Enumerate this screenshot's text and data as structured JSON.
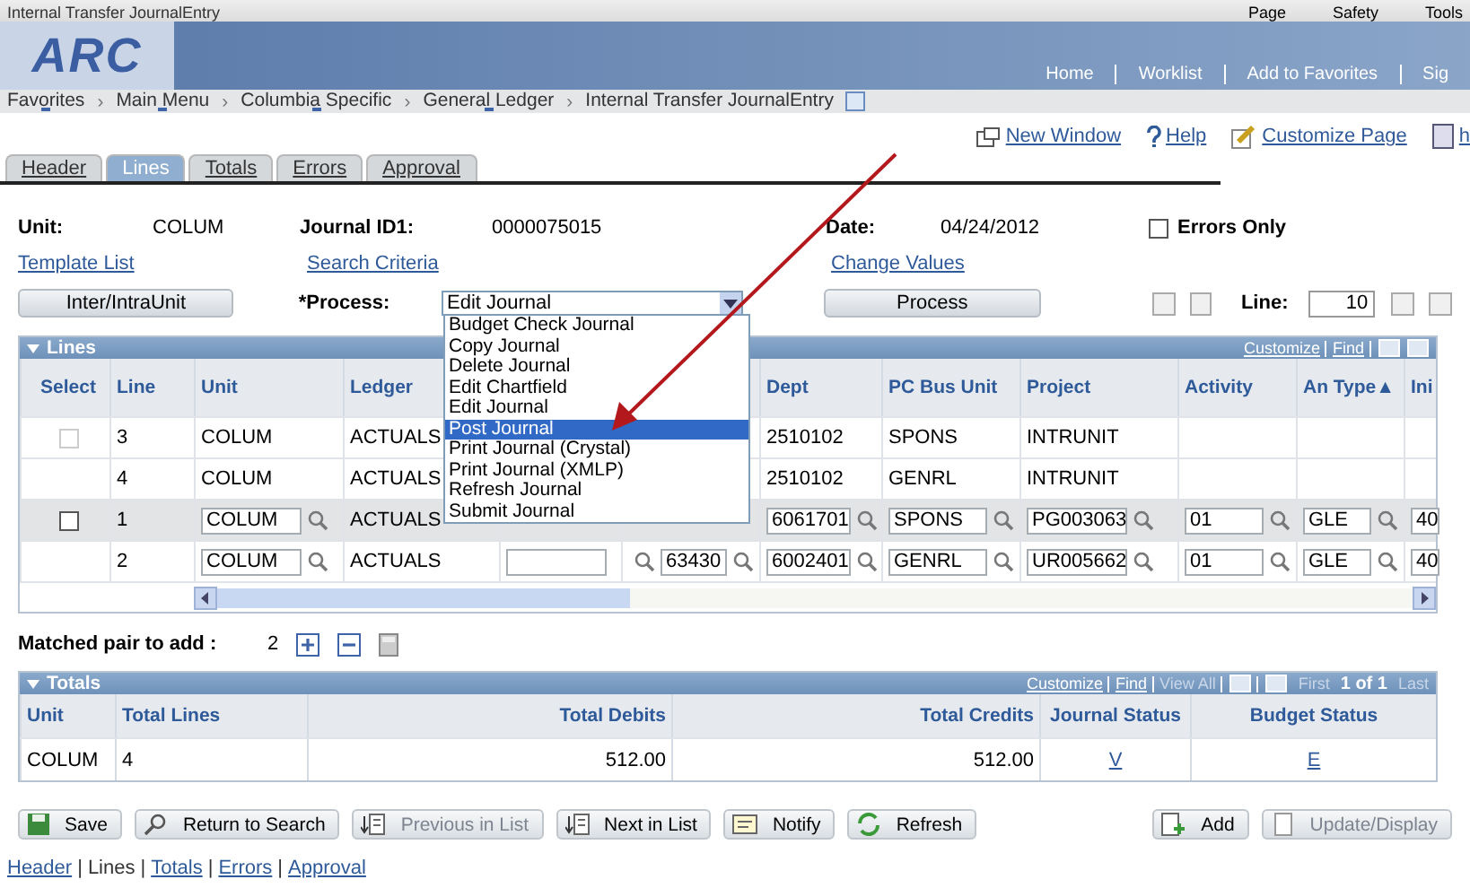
{
  "browser": {
    "title": "Internal Transfer JournalEntry",
    "commands": [
      "Page",
      "Safety",
      "Tools"
    ]
  },
  "banner": {
    "logo": "ARC",
    "links": [
      "Home",
      "Worklist",
      "Add to Favorites",
      "Sig"
    ]
  },
  "breadcrumb": {
    "separator": "›",
    "items": [
      {
        "label": "Favorites",
        "menu": true
      },
      {
        "label": "Main Menu",
        "menu": true
      },
      {
        "label": "Columbia Specific",
        "menu": true
      },
      {
        "label": "General Ledger",
        "menu": true
      },
      {
        "label": "Internal Transfer JournalEntry",
        "menu": false
      }
    ]
  },
  "page_links": [
    "New Window",
    "Help",
    "Customize Page",
    "h"
  ],
  "tabs": [
    {
      "label": "Header",
      "selected": false
    },
    {
      "label": "Lines",
      "selected": true
    },
    {
      "label": "Totals",
      "selected": false
    },
    {
      "label": "Errors",
      "selected": false
    },
    {
      "label": "Approval",
      "selected": false
    }
  ],
  "header": {
    "unit_label": "Unit:",
    "unit": "COLUM",
    "journal_label": "Journal ID1:",
    "journal_id": "0000075015",
    "date_label": "Date:",
    "date": "04/24/2012",
    "errors_only": {
      "label": "Errors Only",
      "checked": false
    },
    "links": [
      "Template List",
      "Search Criteria",
      "Change Values"
    ],
    "inter_button": "Inter/IntraUnit",
    "process_label": "*Process:",
    "process_value": "Edit Journal",
    "process_button": "Process",
    "line_label": "Line:",
    "line_value": "10"
  },
  "dropdown": {
    "options": [
      {
        "label": "Budget Check Journal",
        "selected": false
      },
      {
        "label": "Copy Journal",
        "selected": false
      },
      {
        "label": "Delete Journal",
        "selected": false
      },
      {
        "label": "Edit Chartfield",
        "selected": false
      },
      {
        "label": "Edit Journal",
        "selected": false
      },
      {
        "label": "Post Journal",
        "selected": true
      },
      {
        "label": "Print Journal (Crystal)",
        "selected": false
      },
      {
        "label": "Print Journal (XMLP)",
        "selected": false
      },
      {
        "label": "Refresh Journal",
        "selected": false
      },
      {
        "label": "Submit Journal",
        "selected": false
      }
    ]
  },
  "lines": {
    "title": "Lines",
    "tools": [
      "Customize",
      "Find"
    ],
    "columns": [
      "Select",
      "Line",
      "Unit",
      "Ledger",
      "",
      "",
      "Dept",
      "PC Bus Unit",
      "Project",
      "Activity",
      "An Type▲",
      "Ini"
    ],
    "rows": [
      {
        "highlighted": false,
        "cells": [
          {
            "kind": "checkbox",
            "checked": false,
            "disabled": true
          },
          {
            "kind": "text",
            "value": "3"
          },
          {
            "kind": "text",
            "value": "COLUM"
          },
          {
            "kind": "text",
            "value": "ACTUALS"
          },
          {
            "kind": "empty"
          },
          {
            "kind": "empty"
          },
          {
            "kind": "text",
            "value": "2510102"
          },
          {
            "kind": "text",
            "value": "SPONS"
          },
          {
            "kind": "text",
            "value": "INTRUNIT"
          },
          {
            "kind": "empty"
          },
          {
            "kind": "empty"
          },
          {
            "kind": "empty"
          }
        ]
      },
      {
        "highlighted": false,
        "cells": [
          {
            "kind": "empty"
          },
          {
            "kind": "text",
            "value": "4"
          },
          {
            "kind": "text",
            "value": "COLUM"
          },
          {
            "kind": "text",
            "value": "ACTUALS"
          },
          {
            "kind": "empty"
          },
          {
            "kind": "empty"
          },
          {
            "kind": "text",
            "value": "2510102"
          },
          {
            "kind": "text",
            "value": "GENRL"
          },
          {
            "kind": "text",
            "value": "INTRUNIT"
          },
          {
            "kind": "empty"
          },
          {
            "kind": "empty"
          },
          {
            "kind": "empty"
          }
        ]
      },
      {
        "highlighted": true,
        "cells": [
          {
            "kind": "checkbox",
            "checked": false,
            "disabled": false
          },
          {
            "kind": "text",
            "value": "1"
          },
          {
            "kind": "input",
            "value": "COLUM",
            "lookup": true
          },
          {
            "kind": "text",
            "value": "ACTUALS"
          },
          {
            "kind": "empty"
          },
          {
            "kind": "empty"
          },
          {
            "kind": "input",
            "value": "6061701",
            "lookup": true
          },
          {
            "kind": "input",
            "value": "SPONS",
            "lookup": true
          },
          {
            "kind": "input",
            "value": "PG003063",
            "lookup": true
          },
          {
            "kind": "input",
            "value": "01",
            "lookup": true
          },
          {
            "kind": "input",
            "value": "GLE",
            "lookup": true
          },
          {
            "kind": "input",
            "value": "40"
          }
        ]
      },
      {
        "highlighted": false,
        "cells": [
          {
            "kind": "empty"
          },
          {
            "kind": "text",
            "value": "2"
          },
          {
            "kind": "input",
            "value": "COLUM",
            "lookup": true
          },
          {
            "kind": "text",
            "value": "ACTUALS"
          },
          {
            "kind": "input"
          },
          {
            "kind": "input",
            "value": "63430",
            "lookup": true,
            "lead_lookup": true
          },
          {
            "kind": "input",
            "value": "6002401",
            "lookup": true
          },
          {
            "kind": "input",
            "value": "GENRL",
            "lookup": true
          },
          {
            "kind": "input",
            "value": "UR005662",
            "lookup": true
          },
          {
            "kind": "input",
            "value": "01",
            "lookup": true
          },
          {
            "kind": "input",
            "value": "GLE",
            "lookup": true
          },
          {
            "kind": "input",
            "value": "40"
          }
        ]
      }
    ]
  },
  "matched": {
    "label": "Matched pair to add :",
    "value": "2"
  },
  "totals": {
    "title": "Totals",
    "tools": [
      {
        "label": "Customize",
        "disabled": false
      },
      {
        "label": "Find",
        "disabled": false
      },
      {
        "label": "View All",
        "disabled": true
      }
    ],
    "nav": [
      {
        "label": "First",
        "disabled": true
      },
      {
        "label": "1 of 1",
        "disabled": false
      },
      {
        "label": "Last",
        "disabled": true
      }
    ],
    "columns": [
      "Unit",
      "Total Lines",
      "Total Debits",
      "Total Credits",
      "Journal Status",
      "Budget Status"
    ],
    "row": [
      "COLUM",
      "4",
      "512.00",
      "512.00",
      "V",
      "E"
    ]
  },
  "buttons": [
    {
      "label": "Save",
      "kind": "save",
      "disabled": false
    },
    {
      "label": "Return to Search",
      "kind": "search",
      "disabled": false
    },
    {
      "label": "Previous in List",
      "kind": "prev",
      "disabled": true
    },
    {
      "label": "Next in List",
      "kind": "next",
      "disabled": false
    },
    {
      "label": "Notify",
      "kind": "notify",
      "disabled": false
    },
    {
      "label": "Refresh",
      "kind": "refresh",
      "disabled": false
    }
  ],
  "right_buttons": [
    {
      "label": "Add",
      "kind": "add",
      "disabled": false
    },
    {
      "label": "Update/Display",
      "kind": "update",
      "disabled": true
    }
  ],
  "footer_links": [
    {
      "label": "Header",
      "selected": false
    },
    {
      "label": "Lines",
      "selected": true
    },
    {
      "label": "Totals",
      "selected": false
    },
    {
      "label": "Errors",
      "selected": false
    },
    {
      "label": "Approval",
      "selected": false
    }
  ],
  "footer_separator": "|"
}
